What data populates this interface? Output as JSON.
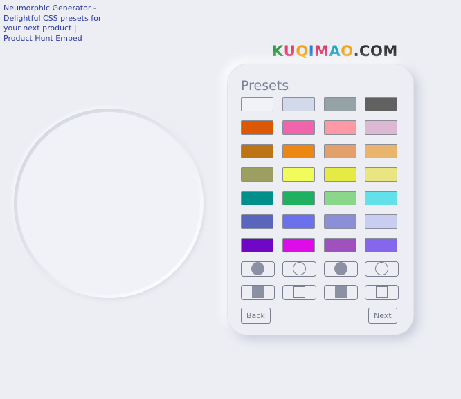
{
  "embed": {
    "alt_text": "Neumorphic Generator - Delightful CSS presets for your next product | Product Hunt Embed"
  },
  "logo": {
    "letters": [
      "K",
      "U",
      "Q",
      "I",
      "M",
      "A",
      "O",
      ".",
      "C",
      "O",
      "M"
    ],
    "colors": [
      "#2e9e44",
      "#e33d6f",
      "#f2a51a",
      "#2b7fd4",
      "#e33d6f",
      "#1fa7c9",
      "#f2a51a",
      "#333333",
      "#333333",
      "#333333",
      "#333333"
    ]
  },
  "presets": {
    "title": "Presets",
    "colors": [
      [
        "#f1f2f7",
        "#d2d9eb",
        "#95a3a8",
        "#616161"
      ],
      [
        "#dc5803",
        "#ee65ac",
        "#ff98a5",
        "#dcb8d3"
      ],
      [
        "#bd7417",
        "#ec8714",
        "#e3a06a",
        "#e9b46b"
      ],
      [
        "#9d9f60",
        "#f1fb5c",
        "#e6ea45",
        "#e8e582"
      ],
      [
        "#008f8a",
        "#1fb15f",
        "#8ad68b",
        "#62e1ea"
      ],
      [
        "#5966bc",
        "#6b71ec",
        "#8c8ed7",
        "#c9cdef"
      ],
      [
        "#6f08c4",
        "#dd0ce9",
        "#9f51bd",
        "#8467ea"
      ]
    ],
    "shapes_row_1": [
      "circle-filled-icon",
      "circle-outline-icon",
      "circle-filled-icon",
      "circle-outline-icon"
    ],
    "shapes_row_2": [
      "square-filled-icon",
      "square-outline-icon",
      "square-filled-icon",
      "square-outline-icon"
    ],
    "back_label": "Back",
    "next_label": "Next"
  }
}
